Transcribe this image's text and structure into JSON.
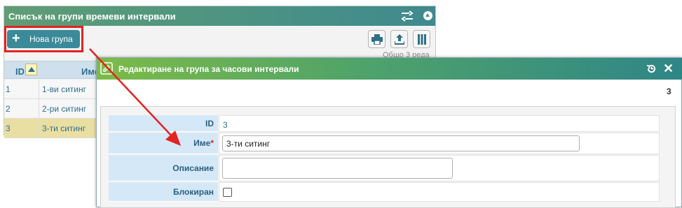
{
  "list_panel": {
    "title": "Списък на групи времеви интервали",
    "new_group_label": "Нова група",
    "total_text": "Общо 3 реда",
    "columns": {
      "id": "ID",
      "name": "Име"
    },
    "rows": [
      {
        "id": "1",
        "name": "1-ви ситинг"
      },
      {
        "id": "2",
        "name": "2-ри ситинг"
      },
      {
        "id": "3",
        "name": "3-ти ситинг"
      }
    ],
    "selected_row": "3"
  },
  "dialog": {
    "title": "Редактиране на група за часови интервали",
    "record_id": "3",
    "fields": {
      "id_label": "ID",
      "id_value": "3",
      "name_label": "Име",
      "name_required_mark": "*",
      "name_value": "3-ти ситинг",
      "description_label": "Описание",
      "description_value": "",
      "blocked_label": "Блокиран",
      "blocked_checked": false
    }
  },
  "colors": {
    "annotation_red": "#e32222",
    "header_green": "#5f9d74",
    "accent_teal": "#3b8a99",
    "selected_row": "#e9dfa2"
  },
  "icons": {
    "settings": "sliders-icon",
    "collapse": "collapse-up-icon",
    "print": "print-icon",
    "upload": "upload-icon",
    "columns": "columns-icon",
    "dialog": "edit-icon",
    "history": "history-icon",
    "close": "close-icon"
  }
}
